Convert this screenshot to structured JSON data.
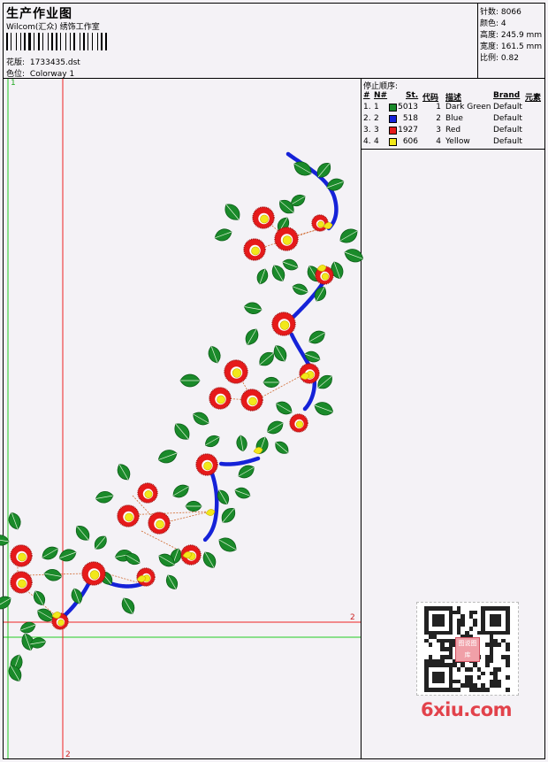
{
  "header": {
    "title": "生产作业图",
    "company": "Wilcom(汇众) 绣饰工作室",
    "design_label": "花版:",
    "design_file": "1733435.dst",
    "colorway_label": "色位:",
    "colorway": "Colorway 1"
  },
  "stats": [
    {
      "label": "针数:",
      "value": "8066"
    },
    {
      "label": "颜色:",
      "value": "4"
    },
    {
      "label": "高度:",
      "value": "245.9 mm"
    },
    {
      "label": "宽度:",
      "value": "161.5 mm"
    },
    {
      "label": "比例:",
      "value": "0.82"
    }
  ],
  "stop_sequence": {
    "title": "停止顺序:",
    "headers": [
      "#",
      "N#",
      "St.",
      "代码",
      "描述",
      "Brand",
      "元素"
    ],
    "rows": [
      {
        "idx": "1.",
        "n": "1",
        "color": "#1a8a2a",
        "st": "5013",
        "code": "1",
        "desc": "Dark Green",
        "brand": "Default"
      },
      {
        "idx": "2.",
        "n": "2",
        "color": "#1522d8",
        "st": "518",
        "code": "2",
        "desc": "Blue",
        "brand": "Default"
      },
      {
        "idx": "3.",
        "n": "3",
        "color": "#e61a1a",
        "st": "1927",
        "code": "3",
        "desc": "Red",
        "brand": "Default"
      },
      {
        "idx": "4.",
        "n": "4",
        "color": "#f2e81a",
        "st": "606",
        "code": "4",
        "desc": "Yellow",
        "brand": "Default"
      }
    ]
  },
  "guides": {
    "green_label": "1",
    "red_label_right": "2",
    "red_label_bottom": "2"
  },
  "watermark": {
    "text": "6xiu.com",
    "stamp": "图说图库"
  },
  "colors": {
    "green": "#1a8a2a",
    "blue": "#1522d8",
    "red": "#e61a1a",
    "yellow": "#f2e81a",
    "guide_green": "#22cc22",
    "guide_red": "#ee2222"
  }
}
